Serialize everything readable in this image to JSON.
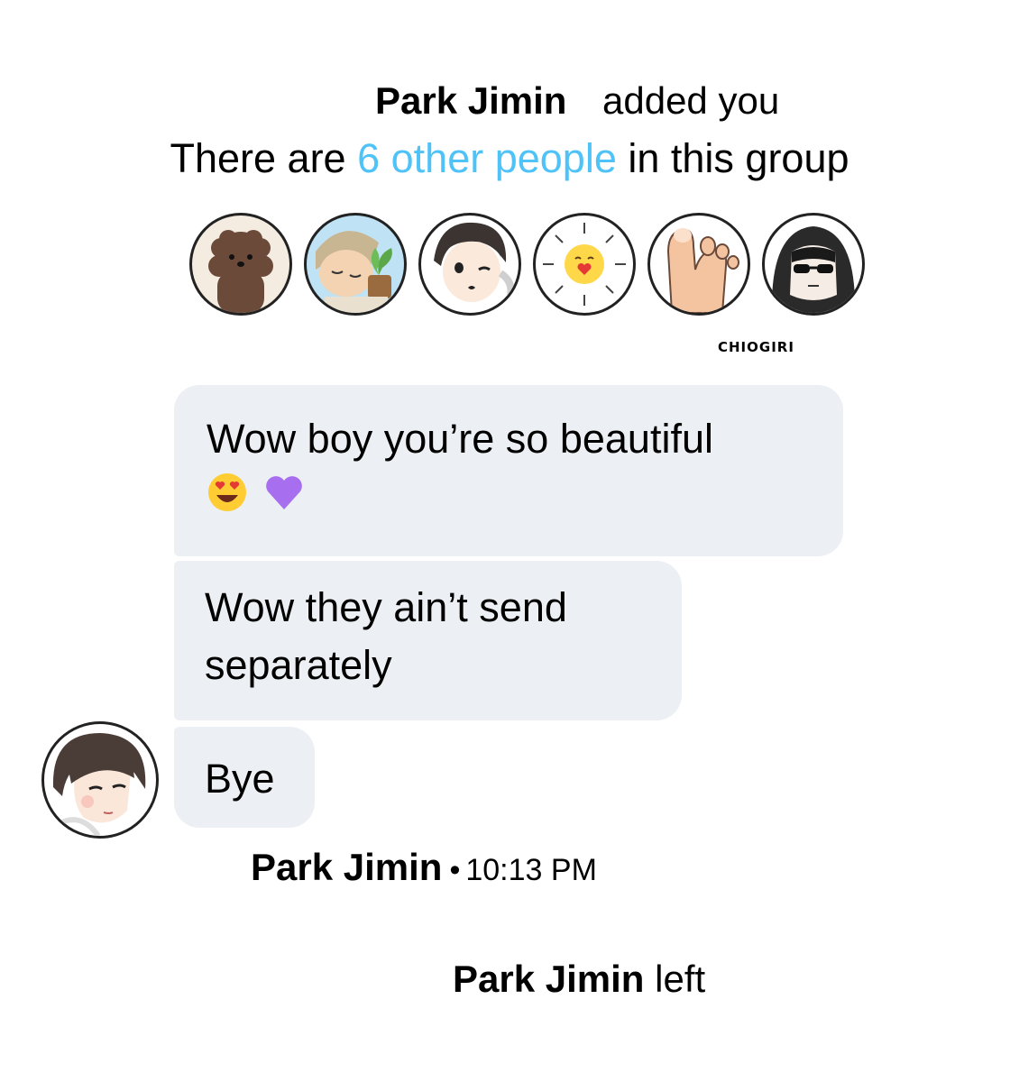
{
  "system": {
    "added_name": "Park Jimin",
    "added_text": "added you",
    "count_prefix": "There are",
    "count_link": "6 other people",
    "count_suffix": "in this group",
    "left_name": "Park Jimin",
    "left_text": "left"
  },
  "members": [
    {
      "icon": "brown-dog-icon"
    },
    {
      "icon": "sleeping-boy-with-plant-icon"
    },
    {
      "icon": "winking-boy-icon"
    },
    {
      "icon": "sun-with-heart-icon"
    },
    {
      "icon": "foot-icon"
    },
    {
      "icon": "hooded-sunglasses-icon"
    }
  ],
  "credit": "CHIOGIRI",
  "messages": [
    {
      "line1": "Wow boy you’re so beautiful",
      "emojis": [
        "heart-eyes-emoji-icon",
        "purple-heart-icon"
      ]
    },
    {
      "line1": "Wow they ain’t send",
      "line2": "separately"
    },
    {
      "line1": "Bye"
    }
  ],
  "sender": {
    "name": "Park Jimin",
    "separator": "•",
    "time": "10:13 PM",
    "avatar_icon": "boy-portrait-avatar-icon"
  },
  "colors": {
    "link": "#4fc3f7",
    "bubble": "#eceff3",
    "text": "#000000"
  }
}
